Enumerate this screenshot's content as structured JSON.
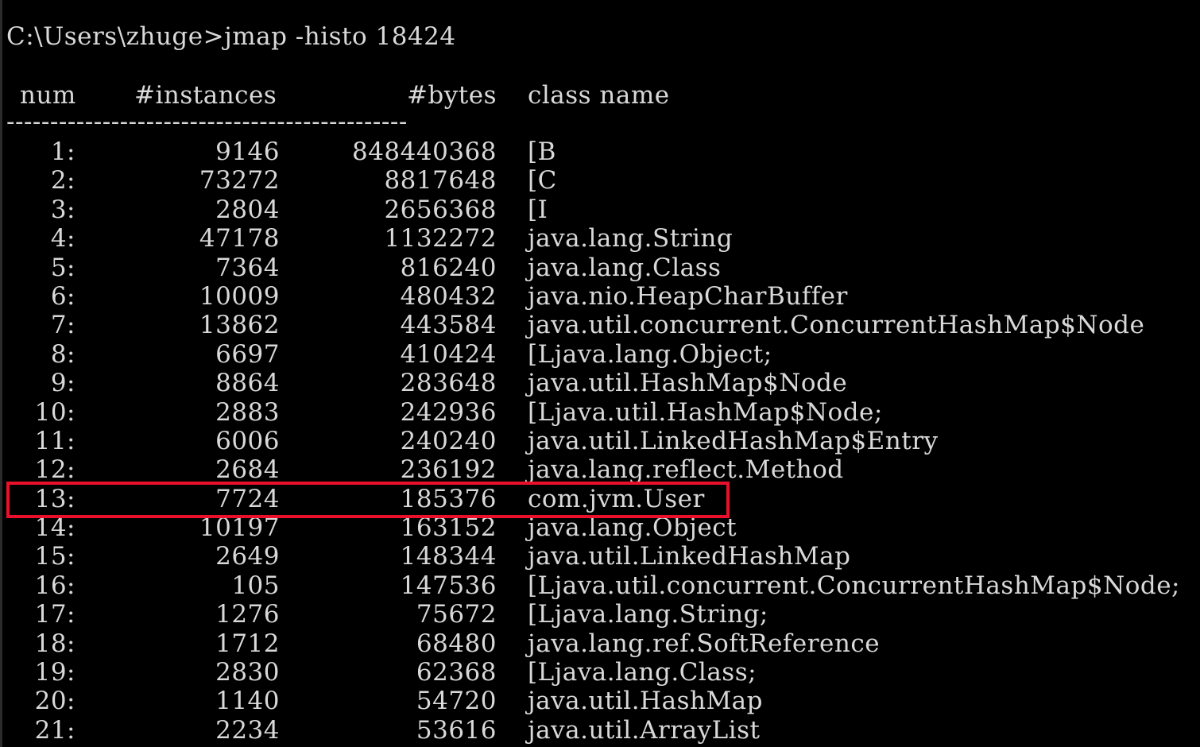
{
  "terminal": {
    "prompt": "C:\\Users\\zhuge>jmap -histo 18424"
  },
  "table": {
    "headers": {
      "num": "num",
      "instances": "#instances",
      "bytes": "#bytes",
      "class_name": "class name"
    },
    "divider": "----------------------------------------------",
    "rows": [
      {
        "num": "1:",
        "instances": "9146",
        "bytes": "848440368",
        "class_name": "[B"
      },
      {
        "num": "2:",
        "instances": "73272",
        "bytes": "8817648",
        "class_name": "[C"
      },
      {
        "num": "3:",
        "instances": "2804",
        "bytes": "2656368",
        "class_name": "[I"
      },
      {
        "num": "4:",
        "instances": "47178",
        "bytes": "1132272",
        "class_name": "java.lang.String"
      },
      {
        "num": "5:",
        "instances": "7364",
        "bytes": "816240",
        "class_name": "java.lang.Class"
      },
      {
        "num": "6:",
        "instances": "10009",
        "bytes": "480432",
        "class_name": "java.nio.HeapCharBuffer"
      },
      {
        "num": "7:",
        "instances": "13862",
        "bytes": "443584",
        "class_name": "java.util.concurrent.ConcurrentHashMap$Node"
      },
      {
        "num": "8:",
        "instances": "6697",
        "bytes": "410424",
        "class_name": "[Ljava.lang.Object;"
      },
      {
        "num": "9:",
        "instances": "8864",
        "bytes": "283648",
        "class_name": "java.util.HashMap$Node"
      },
      {
        "num": "10:",
        "instances": "2883",
        "bytes": "242936",
        "class_name": "[Ljava.util.HashMap$Node;"
      },
      {
        "num": "11:",
        "instances": "6006",
        "bytes": "240240",
        "class_name": "java.util.LinkedHashMap$Entry"
      },
      {
        "num": "12:",
        "instances": "2684",
        "bytes": "236192",
        "class_name": "java.lang.reflect.Method"
      },
      {
        "num": "13:",
        "instances": "7724",
        "bytes": "185376",
        "class_name": "com.jvm.User"
      },
      {
        "num": "14:",
        "instances": "10197",
        "bytes": "163152",
        "class_name": "java.lang.Object"
      },
      {
        "num": "15:",
        "instances": "2649",
        "bytes": "148344",
        "class_name": "java.util.LinkedHashMap"
      },
      {
        "num": "16:",
        "instances": "105",
        "bytes": "147536",
        "class_name": "[Ljava.util.concurrent.ConcurrentHashMap$Node;"
      },
      {
        "num": "17:",
        "instances": "1276",
        "bytes": "75672",
        "class_name": "[Ljava.lang.String;"
      },
      {
        "num": "18:",
        "instances": "1712",
        "bytes": "68480",
        "class_name": "java.lang.ref.SoftReference"
      },
      {
        "num": "19:",
        "instances": "2830",
        "bytes": "62368",
        "class_name": "[Ljava.lang.Class;"
      },
      {
        "num": "20:",
        "instances": "1140",
        "bytes": "54720",
        "class_name": "java.util.HashMap"
      },
      {
        "num": "21:",
        "instances": "2234",
        "bytes": "53616",
        "class_name": "java.util.ArrayList"
      }
    ],
    "highlighted_row": "13:"
  },
  "colors": {
    "background": "#000000",
    "text": "#d9d9d9",
    "highlight_border": "#e8102a"
  }
}
